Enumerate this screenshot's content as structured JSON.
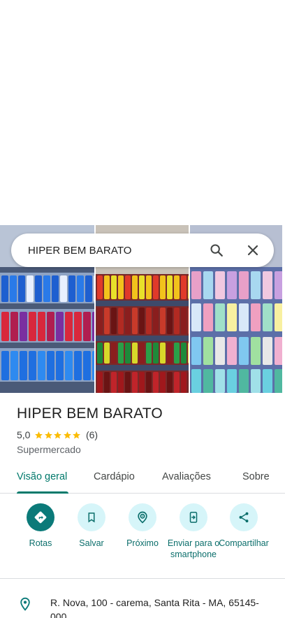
{
  "search": {
    "query": "HIPER BEM BARATO"
  },
  "place": {
    "name": "HIPER BEM BARATO",
    "rating": "5,0",
    "rating_stars": 5,
    "review_count": "(6)",
    "category": "Supermercado"
  },
  "tabs": [
    {
      "label": "Visão geral",
      "active": true
    },
    {
      "label": "Cardápio",
      "active": false
    },
    {
      "label": "Avaliações",
      "active": false
    },
    {
      "label": "Sobre",
      "active": false
    }
  ],
  "actions": [
    {
      "label": "Rotas",
      "icon": "directions-icon"
    },
    {
      "label": "Salvar",
      "icon": "bookmark-icon"
    },
    {
      "label": "Próximo",
      "icon": "nearby-icon"
    },
    {
      "label": "Enviar para o smartphone",
      "icon": "send-to-phone-icon"
    },
    {
      "label": "Compartilhar",
      "icon": "share-icon"
    }
  ],
  "address": {
    "text": "R. Nova, 100 - carema, Santa Rita - MA, 65145-000"
  },
  "colors": {
    "accent": "#0b7a79",
    "star": "#fbbc04",
    "action_bg": "#d6f5f9"
  }
}
